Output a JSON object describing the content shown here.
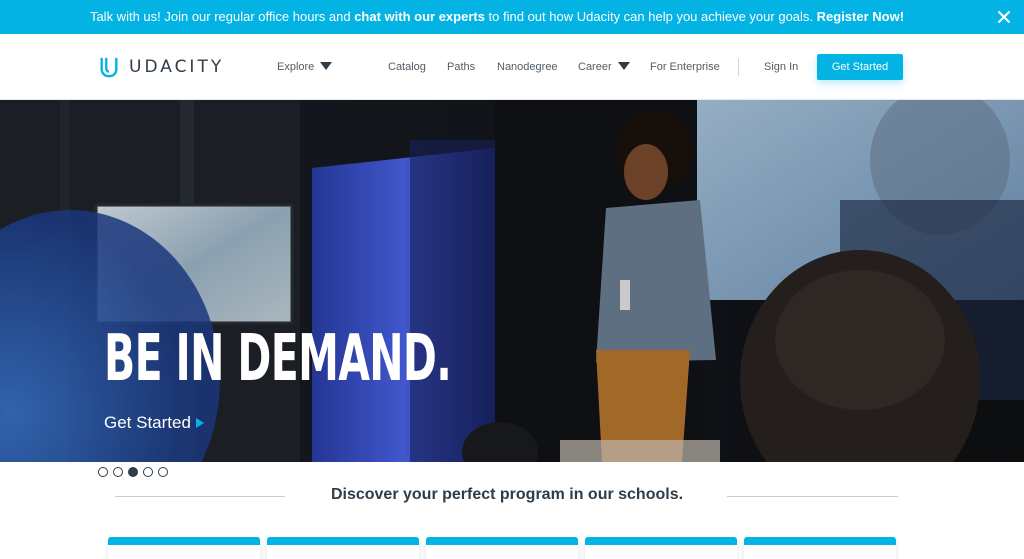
{
  "announcement": {
    "part1": "Talk with us! Join our regular office hours and ",
    "bold1": "chat with our experts",
    "part2": " to find out how Udacity can help you achieve your goals. ",
    "bold2": "Register Now!",
    "close_icon": "close-icon"
  },
  "header": {
    "logo_text": "UDACITY",
    "logo_icon": "udacity-logo-icon",
    "explore": "Explore",
    "nav": [
      "Catalog",
      "Paths",
      "Nanodegree",
      "Career",
      "For Enterprise"
    ],
    "sign_in": "Sign In",
    "get_started": "Get Started"
  },
  "hero": {
    "title": "BE IN DEMAND.",
    "cta": "Get Started",
    "active_slide": 3,
    "slide_count": 5
  },
  "schools": {
    "title": "Discover your perfect program in our schools.",
    "card_count": 5
  },
  "colors": {
    "brand": "#02b3e4",
    "text_dark": "#2e3d49"
  }
}
